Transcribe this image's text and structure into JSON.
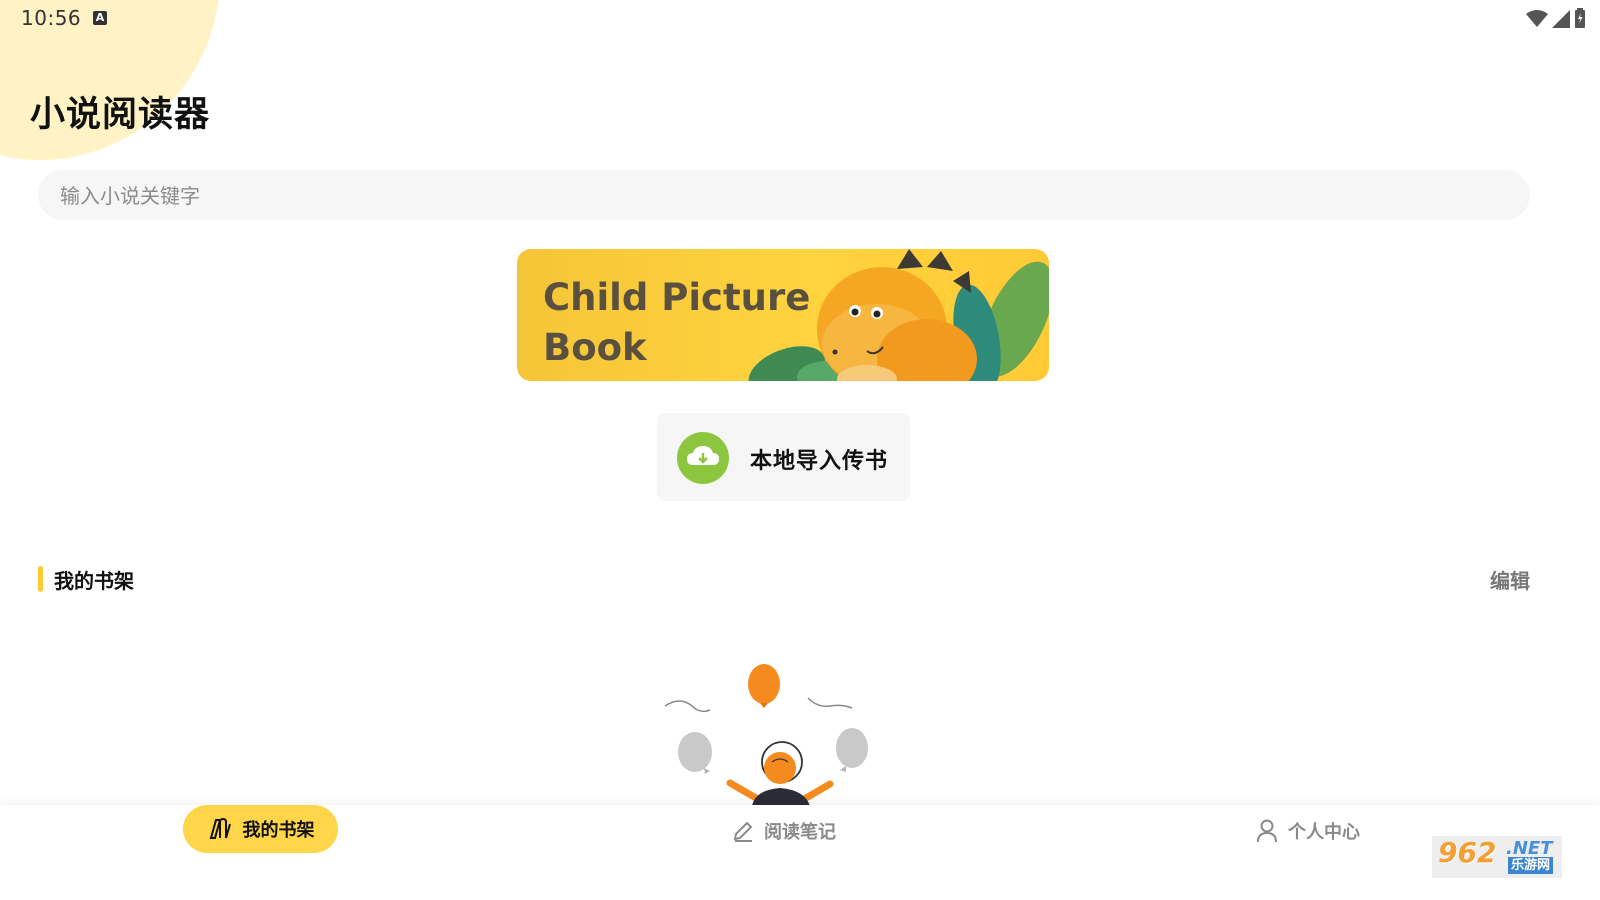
{
  "status_bar": {
    "time": "10:56",
    "notification_icon": "a-icon",
    "indicators": [
      "wifi-icon",
      "signal-icon",
      "battery-icon"
    ]
  },
  "app": {
    "title": "小说阅读器"
  },
  "search": {
    "placeholder": "输入小说关键字",
    "value": ""
  },
  "banner": {
    "line1": "Child Picture",
    "line2": "Book",
    "image": "dinosaur-illustration"
  },
  "import": {
    "label": "本地导入传书",
    "icon": "cloud-download-icon"
  },
  "bookshelf": {
    "title": "我的书架",
    "edit_label": "编辑",
    "empty_illustration": "person-juggling-balloons"
  },
  "bottom_nav": {
    "items": [
      {
        "label": "我的书架",
        "icon": "bookshelf-icon",
        "active": true
      },
      {
        "label": "阅读笔记",
        "icon": "pencil-icon",
        "active": false
      },
      {
        "label": "个人中心",
        "icon": "person-icon",
        "active": false
      }
    ]
  },
  "watermark": {
    "main": "962",
    "suffix": ".NET",
    "sub": "乐游网"
  },
  "colors": {
    "accent": "#ffd54a",
    "section_marker": "#ffcb2f",
    "import_icon": "#8cc63e",
    "banner_bg": "#ffd33f",
    "corner_blob": "#fff2c4"
  }
}
